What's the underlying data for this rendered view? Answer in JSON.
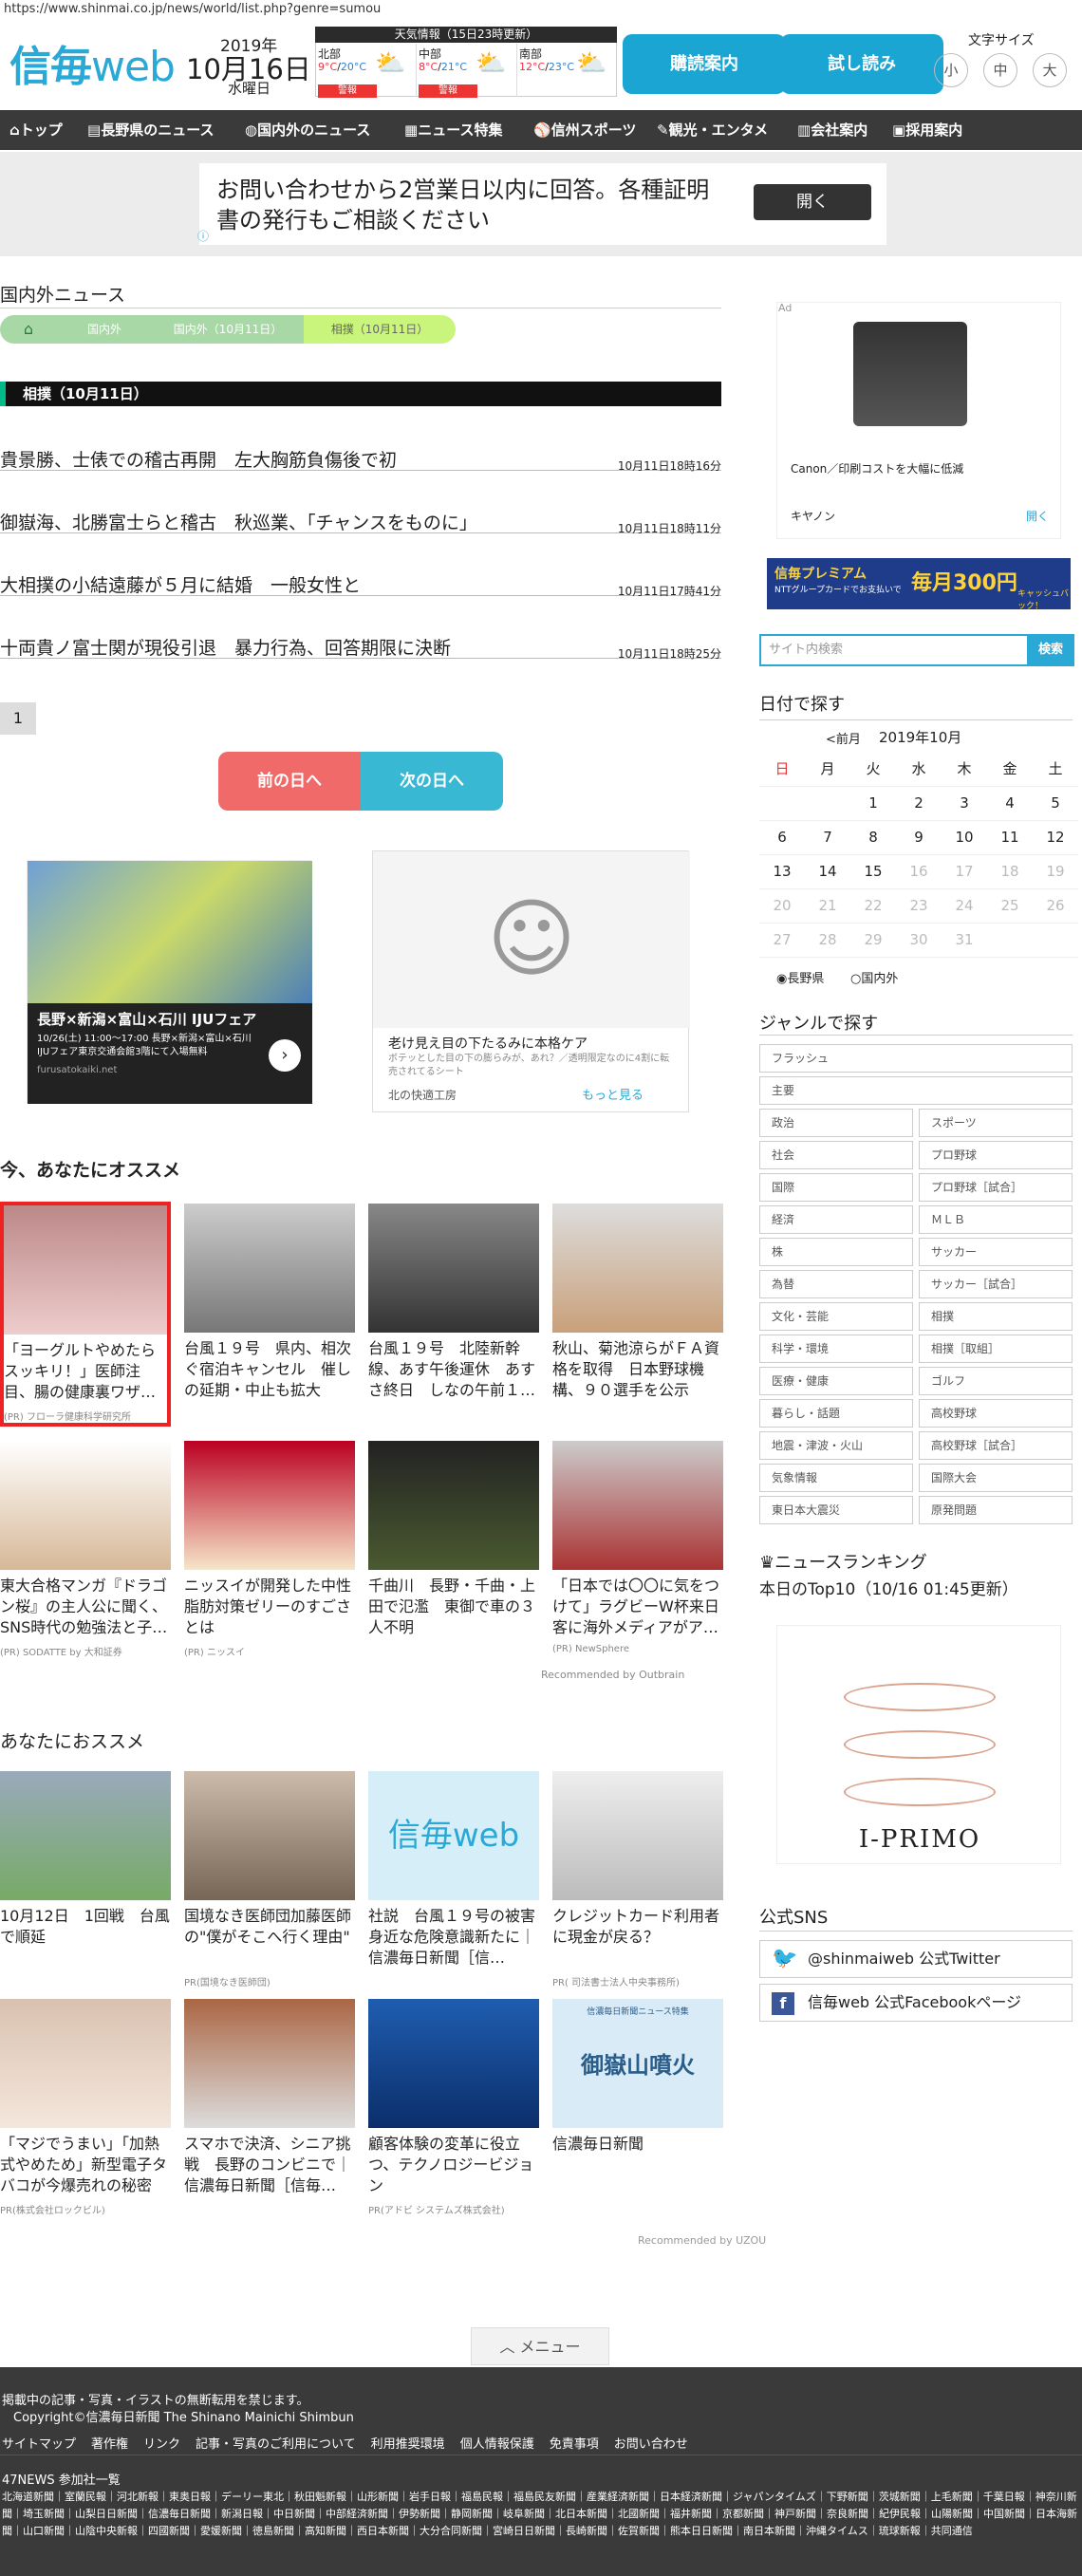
{
  "url": "https://www.shinmai.co.jp/news/world/list.php?genre=sumou",
  "logo": {
    "text1": "信毎",
    "text2": "web"
  },
  "date": {
    "year": "2019年",
    "month_day": "10月16日",
    "weekday": "水曜日"
  },
  "weather": {
    "title": "天気情報（15日23時更新）",
    "cells": [
      {
        "name": "北部",
        "hi": "9°C",
        "lo": "20°C",
        "alert": "警報",
        "icon": "cloud-sun-icon"
      },
      {
        "name": "中部",
        "hi": "8°C",
        "lo": "21°C",
        "alert": "警報",
        "icon": "cloud-sun-icon"
      },
      {
        "name": "南部",
        "hi": "12°C",
        "lo": "23°C",
        "alert": "",
        "icon": "cloud-sun-icon"
      }
    ]
  },
  "top_buttons": {
    "subscribe": "購読案内",
    "trial": "試し読み"
  },
  "font_size": {
    "label": "文字サイズ",
    "small": "小",
    "medium": "中",
    "large": "大"
  },
  "nav": [
    "トップ",
    "長野県のニュース",
    "国内外のニュース",
    "ニュース特集",
    "信州スポーツ",
    "観光・エンタメ",
    "会社案内",
    "採用案内"
  ],
  "top_ad": {
    "text": "お問い合わせから2営業日以内に回答。各種証明書の発行もご相談ください",
    "button": "開く"
  },
  "section_title": "国内外ニュース",
  "breadcrumb": [
    "国内外",
    "国内外（10月11日）",
    "相撲（10月11日）"
  ],
  "list_header": "相撲（10月11日）",
  "articles": [
    {
      "title": "貴景勝、士俵での稽古再開　左大胸筋負傷後で初",
      "date": "10月11日18時16分"
    },
    {
      "title": "御嶽海、北勝富士らと稽古　秋巡業、「チャンスをものに」",
      "date": "10月11日18時11分"
    },
    {
      "title": "大相撲の小結遠藤が５月に結婚　一般女性と",
      "date": "10月11日17時41分"
    },
    {
      "title": "十両貴ノ富士関が現役引退　暴力行為、回答期限に決断",
      "date": "10月11日18時25分"
    }
  ],
  "pagination": "1",
  "day_nav": {
    "prev": "前の日へ",
    "next": "次の日へ"
  },
  "ad_left": {
    "title": "長野×新潟×富山×石川 IJUフェア",
    "sub": "10/26(土) 11:00〜17:00 長野×新潟×富山×石川 IJUフェア東京交通会館3階にて入場無料",
    "domain": "furusatokaiki.net"
  },
  "ad_right": {
    "title": "老け見え目の下たるみに本格ケア",
    "sub": "ボテッとした目の下の膨らみが、あれ？／透明限定なのに4割に転売されてるシート",
    "brand": "北の快適工房",
    "more": "もっと見る"
  },
  "recommend_title": "今、あなたにオススメ",
  "recommend": [
    {
      "title": "「ヨーグルトやめたらスッキリ！」医師注目、腸の健康裏ワザ…",
      "sponsor": "(PR) フローラ健康科学研究所"
    },
    {
      "title": "台風１９号　県内、相次ぐ宿泊キャンセル　催しの延期・中止も拡大",
      "sponsor": ""
    },
    {
      "title": "台風１９号　北陸新幹線、あす午後運休　あすさ終日　しなの午前１…",
      "sponsor": ""
    },
    {
      "title": "秋山、菊池涼らがＦＡ資格を取得　日本野球機構、９０選手を公示",
      "sponsor": ""
    },
    {
      "title": "東大合格マンガ『ドラゴン桜』の主人公に聞く、SNS時代の勉強法と子…",
      "sponsor": "(PR) SODATTE by 大和証券"
    },
    {
      "title": "ニッスイが開発した中性脂肪対策ゼリーのすごさとは",
      "sponsor": "(PR) ニッスイ"
    },
    {
      "title": "千曲川　長野・千曲・上田で氾濫　東御で車の３人不明",
      "sponsor": ""
    },
    {
      "title": "「日本では〇〇に気をつけて」ラグビーW杯来日客に海外メディアがア…",
      "sponsor": "(PR) NewSphere"
    }
  ],
  "outbrain": "Recommended by Outbrain",
  "recommend2_title": "あなたにおススメ",
  "recommend2": [
    {
      "title": "10月12日　1回戦　台風で順延",
      "sponsor": ""
    },
    {
      "title": "国境なき医師団加藤医師の\"僕がそこへ行く理由\"",
      "sponsor": "PR(国境なき医師団)"
    },
    {
      "title": "社説　台風１９号の被害　身近な危険意識新たに｜信濃毎日新聞［信…",
      "sponsor": ""
    },
    {
      "title": "クレジットカード利用者に現金が戻る？",
      "sponsor": "PR( 司法書士法人中央事務所)"
    },
    {
      "title": "「マジでうまい」「加熱式やめため」新型電子タバコが今爆売れの秘密",
      "sponsor": "PR(株式会社ロックビル)"
    },
    {
      "title": "スマホで決済、シニア挑戦　長野のコンビニで｜信濃毎日新聞［信毎…",
      "sponsor": ""
    },
    {
      "title": "顧客体験の変革に役立つ、テクノロジービジョン",
      "sponsor": "PR(アドビ システムズ株式会社)"
    },
    {
      "title": "信濃毎日新聞",
      "sponsor": ""
    }
  ],
  "recommend2_thumb_labels": {
    "shinmai": "信毎web",
    "ontake": "御嶽山噴火",
    "ontake_top": "信濃毎日新聞ニュース特集"
  },
  "uzou": "Recommended by UZOU",
  "menu_button": "メニュー",
  "footer": {
    "line1": "掲載中の記事・写真・イラストの無断転用を禁じます。",
    "line2": "Copyright©信濃毎日新聞 The Shinano Mainichi Shimbun",
    "links": [
      "サイトマップ",
      "著作権",
      "リンク",
      "記事・写真のご利用について",
      "利用推奨環境",
      "個人情報保護",
      "免責事項",
      "お問い合わせ"
    ],
    "news47": "47NEWS 参加社一覧",
    "papers": "北海道新聞｜室蘭民報｜河北新報｜東奥日報｜デーリー東北｜秋田魁新報｜山形新聞｜岩手日報｜福島民報｜福島民友新聞｜産業経済新聞｜日本経済新聞｜ジャパンタイムズ｜下野新聞｜茨城新聞｜上毛新聞｜千葉日報｜神奈川新聞｜埼玉新聞｜山梨日日新聞｜信濃毎日新聞｜新潟日報｜中日新聞｜中部経済新聞｜伊勢新聞｜静岡新聞｜岐阜新聞｜北日本新聞｜北國新聞｜福井新聞｜京都新聞｜神戸新聞｜奈良新聞｜紀伊民報｜山陽新聞｜中国新聞｜日本海新聞｜山口新聞｜山陰中央新報｜四國新聞｜愛媛新聞｜徳島新聞｜高知新聞｜西日本新聞｜大分合同新聞｜宮崎日日新聞｜長崎新聞｜佐賀新聞｜熊本日日新聞｜南日本新聞｜沖縄タイムス｜琉球新報｜共同通信"
  },
  "side_ad1": {
    "caption": "Canon／印刷コストを大幅に低減",
    "brand": "キヤノン",
    "open": "開く"
  },
  "side_ad2": {
    "text": "信毎プレミアム",
    "sub": "NTTグループカードでお支払いで",
    "cash": "毎月300円",
    "tail": "キャッシュバック！"
  },
  "search": {
    "placeholder": "サイト内検索",
    "button": "検索"
  },
  "calendar": {
    "title": "日付で探す",
    "prev": "<前月",
    "month": "2019年10月",
    "weekdays": [
      "日",
      "月",
      "火",
      "水",
      "木",
      "金",
      "土"
    ],
    "weeks": [
      [
        "",
        "",
        "1",
        "2",
        "3",
        "4",
        "5"
      ],
      [
        "6",
        "7",
        "8",
        "9",
        "10",
        "11",
        "12"
      ],
      [
        "13",
        "14",
        "15",
        "16",
        "17",
        "18",
        "19"
      ],
      [
        "20",
        "21",
        "22",
        "23",
        "24",
        "25",
        "26"
      ],
      [
        "27",
        "28",
        "29",
        "30",
        "31",
        "",
        ""
      ]
    ],
    "radio": [
      "長野県",
      "国内外"
    ]
  },
  "genre": {
    "title": "ジャンルで探す",
    "full": [
      "フラッシュ",
      "主要"
    ],
    "grid": [
      "政治",
      "スポーツ",
      "社会",
      "プロ野球",
      "国際",
      "プロ野球［試合］",
      "経済",
      "ＭＬＢ",
      "株",
      "サッカー",
      "為替",
      "サッカー［試合］",
      "文化・芸能",
      "相撲",
      "科学・環境",
      "相撲［取組］",
      "医療・健康",
      "ゴルフ",
      "暮らし・話題",
      "高校野球",
      "地震・津波・火山",
      "高校野球［試合］",
      "気象情報",
      "国際大会",
      "東日本大震災",
      "原発問題"
    ]
  },
  "ranking": {
    "title": "ニュースランキング",
    "sub": "本日のTop10（10/16 01:45更新）",
    "ad": "I-PRIMO"
  },
  "sns": {
    "title": "公式SNS",
    "twitter": "@shinmaiweb 公式Twitter",
    "facebook": "信毎web 公式Facebookページ"
  },
  "ad_marker": "Ad"
}
